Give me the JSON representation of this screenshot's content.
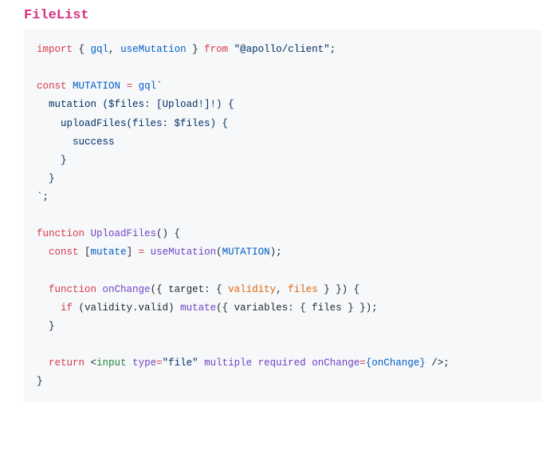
{
  "title": "FileList",
  "code": {
    "l1_1": "import",
    "l1_2": " { ",
    "l1_3": "gql",
    "l1_4": ", ",
    "l1_5": "useMutation",
    "l1_6": " } ",
    "l1_7": "from",
    "l1_8": " ",
    "l1_9": "\"@apollo/client\"",
    "l1_10": ";",
    "l3_1": "const",
    "l3_2": " ",
    "l3_3": "MUTATION",
    "l3_4": " ",
    "l3_5": "=",
    "l3_6": " ",
    "l3_7": "gql",
    "l3_8": "`",
    "l4": "  mutation ($files: [Upload!]!) {",
    "l5": "    uploadFiles(files: $files) {",
    "l6": "      success",
    "l7": "    }",
    "l8": "  }",
    "l9_1": "`",
    "l9_2": ";",
    "l11_1": "function",
    "l11_2": " ",
    "l11_3": "UploadFiles",
    "l11_4": "() {",
    "l12_1": "  ",
    "l12_2": "const",
    "l12_3": " [",
    "l12_4": "mutate",
    "l12_5": "] ",
    "l12_6": "=",
    "l12_7": " ",
    "l12_8": "useMutation",
    "l12_9": "(",
    "l12_10": "MUTATION",
    "l12_11": ");",
    "l14_1": "  ",
    "l14_2": "function",
    "l14_3": " ",
    "l14_4": "onChange",
    "l14_5": "({ target: { ",
    "l14_6": "validity",
    "l14_7": ", ",
    "l14_8": "files",
    "l14_9": " } }) {",
    "l15_1": "    ",
    "l15_2": "if",
    "l15_3": " (validity.valid) ",
    "l15_4": "mutate",
    "l15_5": "({ variables: { files } });",
    "l16": "  }",
    "l18_1": "  ",
    "l18_2": "return",
    "l18_3": " <",
    "l18_4": "input",
    "l18_5": " ",
    "l18_6": "type",
    "l18_7": "=",
    "l18_8": "\"file\"",
    "l18_9": " ",
    "l18_10": "multiple",
    "l18_11": " ",
    "l18_12": "required",
    "l18_13": " ",
    "l18_14": "onChange",
    "l18_15": "=",
    "l18_16": "{onChange}",
    "l18_17": " />;",
    "l19": "}"
  }
}
